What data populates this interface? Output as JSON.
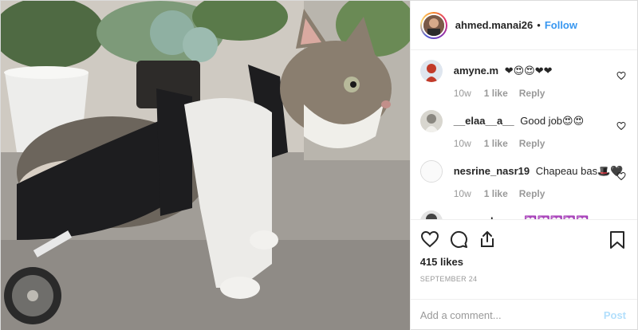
{
  "header": {
    "username": "ahmed.manai26",
    "separator": "•",
    "follow_label": "Follow"
  },
  "comments": [
    {
      "user": "amyne.m",
      "text": "❤😍😍❤❤",
      "time": "10w",
      "likes": "1 like",
      "reply": "Reply",
      "avatar_color": "#c23b2a"
    },
    {
      "user": "__elaa__a__",
      "text": "Good job😍😍",
      "time": "10w",
      "likes": "1 like",
      "reply": "Reply",
      "avatar_color": "#b5b5b0"
    },
    {
      "user": "nesrine_nasr19",
      "text": "Chapeau bas🎩🖤",
      "time": "10w",
      "likes": "1 like",
      "reply": "Reply",
      "avatar_color": "#fafafa"
    },
    {
      "user": "samoudryem",
      "text": "💟💟💟💟💟",
      "time": "",
      "likes": "",
      "reply": "",
      "avatar_color": "#444444"
    }
  ],
  "actions": {
    "icons": [
      "heart-icon",
      "comment-icon",
      "share-icon",
      "bookmark-icon"
    ],
    "likes_count": "415 likes",
    "date": "September 24"
  },
  "add_comment": {
    "placeholder": "Add a comment...",
    "post_label": "Post"
  },
  "colors": {
    "link": "#3897f0",
    "post_disabled": "#b2dffc",
    "muted": "#999999",
    "text": "#262626"
  }
}
